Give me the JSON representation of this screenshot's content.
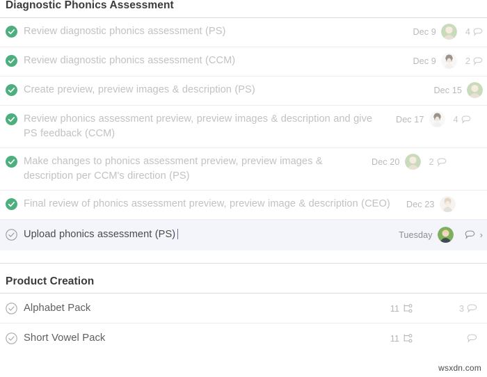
{
  "sections": [
    {
      "title": "Diagnostic Phonics Assessment",
      "tasks": [
        {
          "text": "Review diagnostic phonics assessment (PS)",
          "state": "done",
          "date": "Dec 9",
          "avatar": "avatar-green-blonde",
          "comments": "4"
        },
        {
          "text": "Review diagnostic phonics assessment (CCM)",
          "state": "done",
          "date": "Dec 9",
          "avatar": "avatar-white-darkhair",
          "comments": "2"
        },
        {
          "text": "Create preview, preview images & description (PS)",
          "state": "done",
          "date": "Dec 15",
          "avatar": "avatar-green-blonde",
          "comments": ""
        },
        {
          "text": "Review phonics assessment preview, preview images & description and give PS feedback (CCM)",
          "state": "done",
          "date": "Dec 17",
          "avatar": "avatar-white-darkhair",
          "comments": "4"
        },
        {
          "text": "Make changes to phonics assessment preview, preview images & description per CCM's direction (PS)",
          "state": "done",
          "date": "Dec 20",
          "avatar": "avatar-green-blonde",
          "comments": "2"
        },
        {
          "text": "Final review of phonics assessment preview, preview image & description (CEO)",
          "state": "done",
          "date": "Dec 23",
          "avatar": "avatar-pale-blonde",
          "comments": ""
        },
        {
          "text": "Upload phonics assessment (PS)",
          "state": "open",
          "date": "Tuesday",
          "avatar": "avatar-green-blonde",
          "comments": "",
          "selected": true,
          "editing": true,
          "chevron": "›"
        }
      ]
    },
    {
      "title": "Product Creation",
      "products": [
        {
          "text": "Alphabet Pack",
          "state": "open",
          "subtasks": "11",
          "comments": "3"
        },
        {
          "text": "Short Vowel Pack",
          "state": "open",
          "subtasks": "11",
          "comments": ""
        }
      ]
    }
  ],
  "icons": {
    "check_done": "check-circle-filled-icon",
    "check_open": "check-circle-outline-icon",
    "comment": "comment-bubble-icon",
    "subtask": "subtask-branch-icon",
    "chevron": "chevron-right-icon"
  },
  "colors": {
    "done_green": "#4caf7d",
    "selected_row_bg": "#f4f4fb",
    "muted_text": "#c2c2c2",
    "active_text": "#4a4a4a",
    "divider": "#ececec"
  },
  "watermark": "wsxdn.com"
}
